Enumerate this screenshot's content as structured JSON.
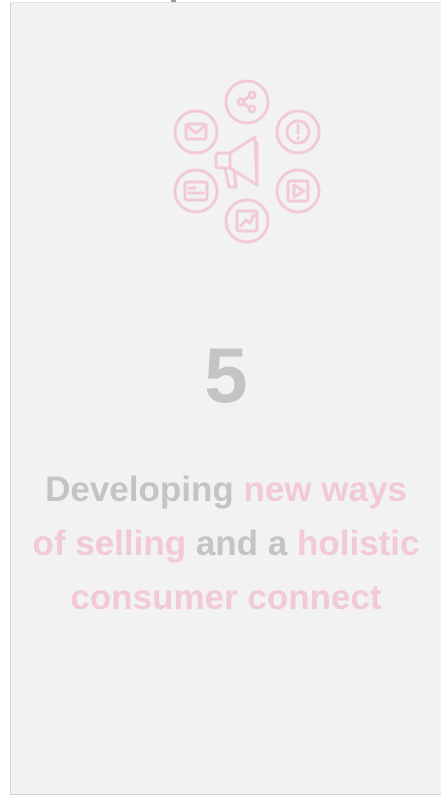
{
  "card": {
    "number": "5",
    "headline": {
      "line1": {
        "grey": "Developing ",
        "pink": "new ways"
      },
      "line2": {
        "pink_a": "of selling",
        "grey": " and a ",
        "pink_b": "holistic"
      },
      "line3": {
        "pink": "consumer connect"
      }
    }
  },
  "colors": {
    "background": "#f2f2f2",
    "accent_pink": "#f1c9d9",
    "text_grey": "#c4c4c4"
  },
  "icons": {
    "center": "megaphone-icon",
    "orbit": [
      "share-icon",
      "alert-icon",
      "play-icon",
      "chart-icon",
      "document-icon",
      "mail-icon"
    ]
  }
}
